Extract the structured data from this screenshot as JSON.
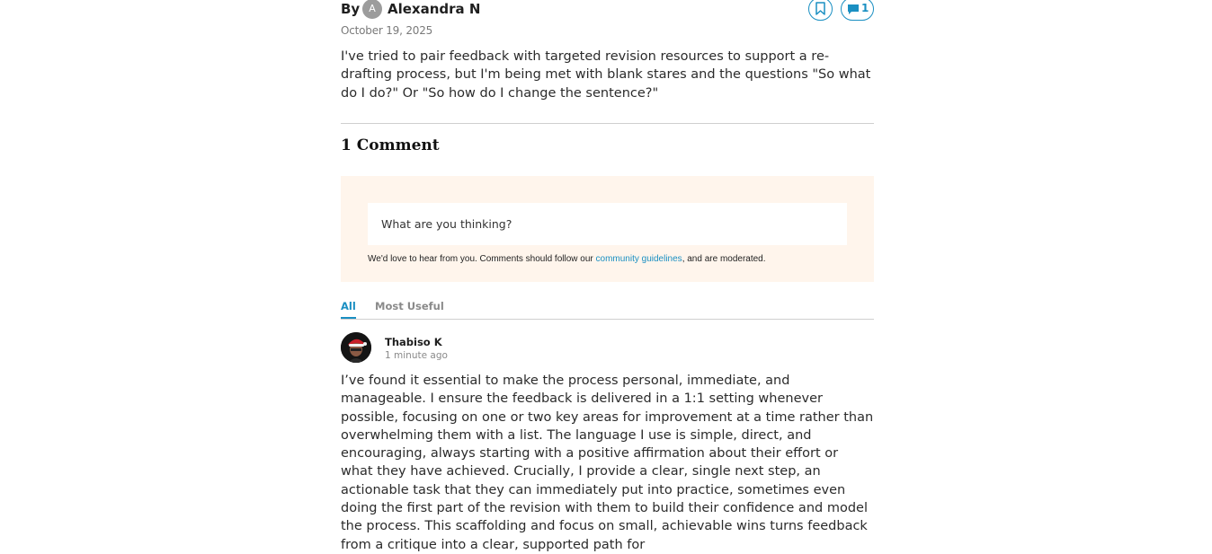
{
  "post": {
    "by_label": "By",
    "author_initial": "A",
    "author_name": "Alexandra N",
    "comment_count_badge": "1",
    "date": "October 19, 2025",
    "body": "I've tried to pair feedback with targeted revision resources to support a re-drafting process, but I'm being met with blank stares and the questions \"So what do I do?\" Or \"So how do I change the sentence?\""
  },
  "comments_section": {
    "heading": "1 Comment",
    "compose": {
      "placeholder": "What are you thinking?",
      "guidelines_before": "We'd love to hear from you. Comments should follow our ",
      "guidelines_link": "community guidelines",
      "guidelines_after": ", and are moderated."
    },
    "tabs": [
      {
        "label": "All",
        "active": true
      },
      {
        "label": "Most Useful",
        "active": false
      }
    ],
    "comments": [
      {
        "author": "Thabiso K",
        "time": "1 minute ago",
        "body": "I’ve found it essential to make the process personal, immediate, and manageable. I ensure the feedback is delivered in a 1:1 setting whenever possible, focusing on one or two key areas for improvement at a time rather than overwhelming them with a list. The language I use is simple, direct, and encouraging, always starting with a positive affirmation about their effort or what they have achieved. Crucially, I provide a clear, single next step, an actionable task that they can immediately put into practice, sometimes even doing the first part of the revision with them to build their confidence and model the process. This scaffolding and focus on small, achievable wins turns feedback from a critique into a clear, supported path for"
      }
    ]
  },
  "icons": {
    "bookmark": "bookmark-icon",
    "comment": "speech-bubble-icon"
  },
  "colors": {
    "accent": "#1a8fc2",
    "compose_background": "#fff5ec",
    "muted_text": "#8a8a8a"
  }
}
